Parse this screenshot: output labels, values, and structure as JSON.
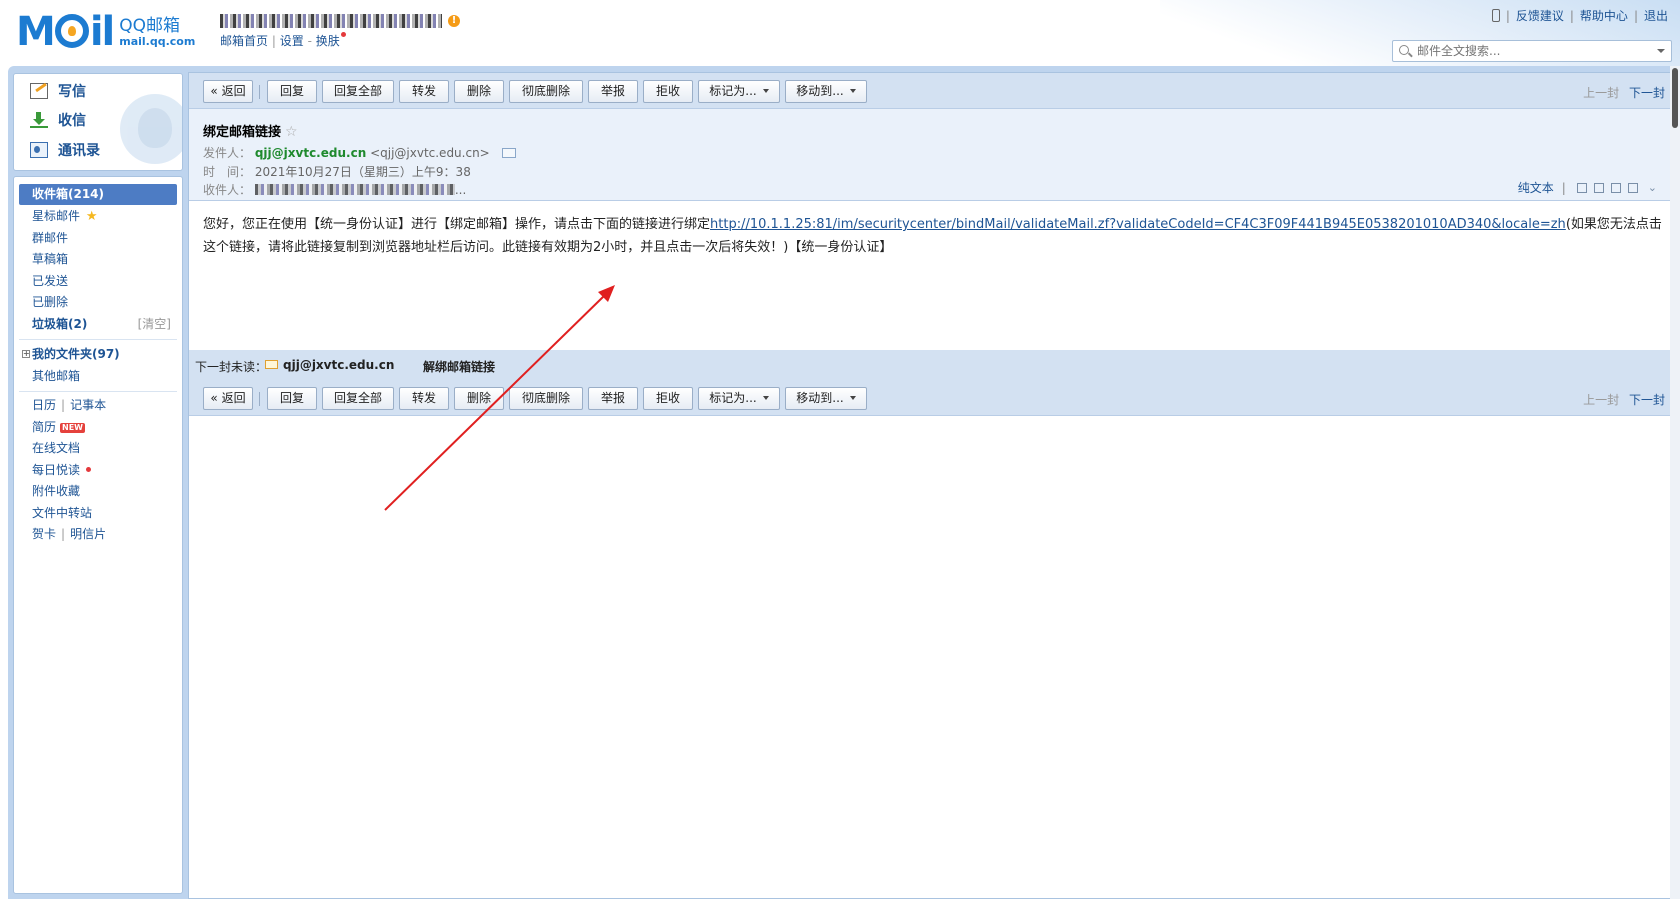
{
  "header": {
    "logo_mark_left": "M",
    "logo_mark_right": "il",
    "logo_name": "QQ邮箱",
    "logo_domain": "mail.qq.com",
    "warn_glyph": "!",
    "nav": {
      "home": "邮箱首页",
      "sep": "|",
      "settings": "设置",
      "dash": "-",
      "skin": "换肤"
    },
    "top_links": {
      "sep": "|",
      "feedback": "反馈建议",
      "help": "帮助中心",
      "logout": "退出"
    },
    "search": {
      "placeholder": "邮件全文搜索..."
    }
  },
  "quick_actions": {
    "write": "写信",
    "receive": "收信",
    "contacts": "通讯录"
  },
  "folders": {
    "inbox": "收件箱(214)",
    "starred": "星标邮件",
    "group": "群邮件",
    "drafts": "草稿箱",
    "sent": "已发送",
    "deleted": "已删除",
    "junk": "垃圾箱(2)",
    "junk_clear": "[清空]",
    "my_folders": "我的文件夹(97)",
    "other_mail": "其他邮箱",
    "calendar": "日历",
    "notes": "记事本",
    "resume": "简历",
    "new_badge": "NEW",
    "docs": "在线文档",
    "daily": "每日悦读",
    "attachments": "附件收藏",
    "transfer": "文件中转站",
    "greeting_card": "贺卡",
    "postcard": "明信片",
    "sep": "|",
    "plus": "+"
  },
  "toolbar": {
    "back": "« 返回",
    "reply": "回复",
    "reply_all": "回复全部",
    "forward": "转发",
    "delete": "删除",
    "delete_forever": "彻底删除",
    "report": "举报",
    "reject": "拒收",
    "mark_as": "标记为...",
    "move_to": "移动到...",
    "prev": "上一封",
    "next": "下一封"
  },
  "mail": {
    "subject": "绑定邮箱链接",
    "star_glyph": "☆",
    "from_label": "发件人：",
    "from_name": "qjj@jxvtc.edu.cn",
    "from_addr": "<qjj@jxvtc.edu.cn>",
    "time_label": "时　间：",
    "time": "2021年10月27日（星期三）上午9：38",
    "to_label": "收件人：",
    "to_more": "...",
    "plain_text": "纯文本",
    "tools_sep": "|",
    "expand_glyph": "⌄",
    "body_before": "您好，您正在使用【统一身份认证】进行【绑定邮箱】操作，请点击下面的链接进行绑定",
    "body_link": "http://10.1.1.25:81/im/securitycenter/bindMail/validateMail.zf?validateCodeId=CF4C3F09F441B945E0538201010AD340&locale=zh",
    "body_after": "(如果您无法点击这个链接，请将此链接复制到浏览器地址栏后访问。此链接有效期为2小时，并且点击一次后将失效！)【统一身份认证】"
  },
  "next_unread": {
    "label": "下一封未读：",
    "sender": "qjj@jxvtc.edu.cn",
    "subject": "解绑邮箱链接"
  },
  "colors": {
    "accent": "#4d7cc4",
    "frame": "#bed4ee",
    "link": "#1e5494",
    "sender_green": "#1f8a2e",
    "annotation_arrow": "#e02020"
  }
}
